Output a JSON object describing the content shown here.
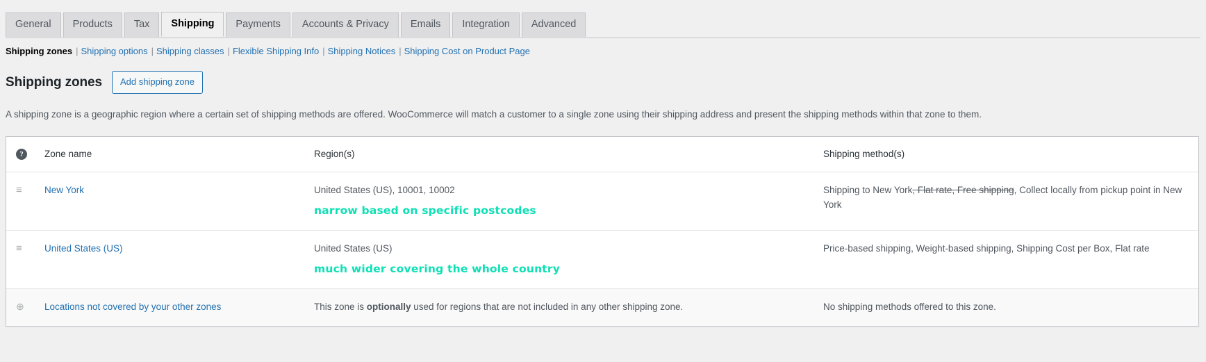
{
  "tabs": [
    {
      "label": "General",
      "active": false
    },
    {
      "label": "Products",
      "active": false
    },
    {
      "label": "Tax",
      "active": false
    },
    {
      "label": "Shipping",
      "active": true
    },
    {
      "label": "Payments",
      "active": false
    },
    {
      "label": "Accounts & Privacy",
      "active": false
    },
    {
      "label": "Emails",
      "active": false
    },
    {
      "label": "Integration",
      "active": false
    },
    {
      "label": "Advanced",
      "active": false
    }
  ],
  "subnav": {
    "items": [
      {
        "label": "Shipping zones",
        "current": true
      },
      {
        "label": "Shipping options",
        "current": false
      },
      {
        "label": "Shipping classes",
        "current": false
      },
      {
        "label": "Flexible Shipping Info",
        "current": false
      },
      {
        "label": "Shipping Notices",
        "current": false
      },
      {
        "label": "Shipping Cost on Product Page",
        "current": false
      }
    ],
    "separator": "|"
  },
  "header": {
    "title": "Shipping zones",
    "add_button": "Add shipping zone",
    "description": "A shipping zone is a geographic region where a certain set of shipping methods are offered. WooCommerce will match a customer to a single zone using their shipping address and present the shipping methods within that zone to them."
  },
  "table": {
    "columns": {
      "sort_help_icon": "?",
      "zone_name": "Zone name",
      "regions": "Region(s)",
      "methods": "Shipping method(s)"
    },
    "rows": [
      {
        "sort_icon": "drag-handle-icon",
        "name": "New York",
        "regions": "United States (US), 10001, 10002",
        "annotation": "narrow based on specific postcodes",
        "methods_prefix": "Shipping to New York",
        "methods_struck": ", Flat rate, Free shipping",
        "methods_suffix": ", Collect locally from pickup point in New York"
      },
      {
        "sort_icon": "drag-handle-icon",
        "name": "United States (US)",
        "regions": "United States (US)",
        "annotation": "much wider covering the whole country",
        "methods_prefix": "Price-based shipping, Weight-based shipping, Shipping Cost per Box, Flat rate",
        "methods_struck": "",
        "methods_suffix": ""
      },
      {
        "sort_icon": "globe-icon",
        "name": "Locations not covered by your other zones",
        "regions_pre": "This zone is ",
        "regions_bold": "optionally",
        "regions_post": " used for regions that are not included in any other shipping zone.",
        "methods_prefix": "No shipping methods offered to this zone.",
        "methods_struck": "",
        "methods_suffix": ""
      }
    ]
  },
  "icons": {
    "drag_handle": "≡",
    "globe": "⊕",
    "help": "?"
  },
  "colors": {
    "link": "#2271b1",
    "annotation": "#0ce0b4",
    "page_bg": "#f0f0f1",
    "table_bg": "#ffffff",
    "text": "#50575e"
  }
}
